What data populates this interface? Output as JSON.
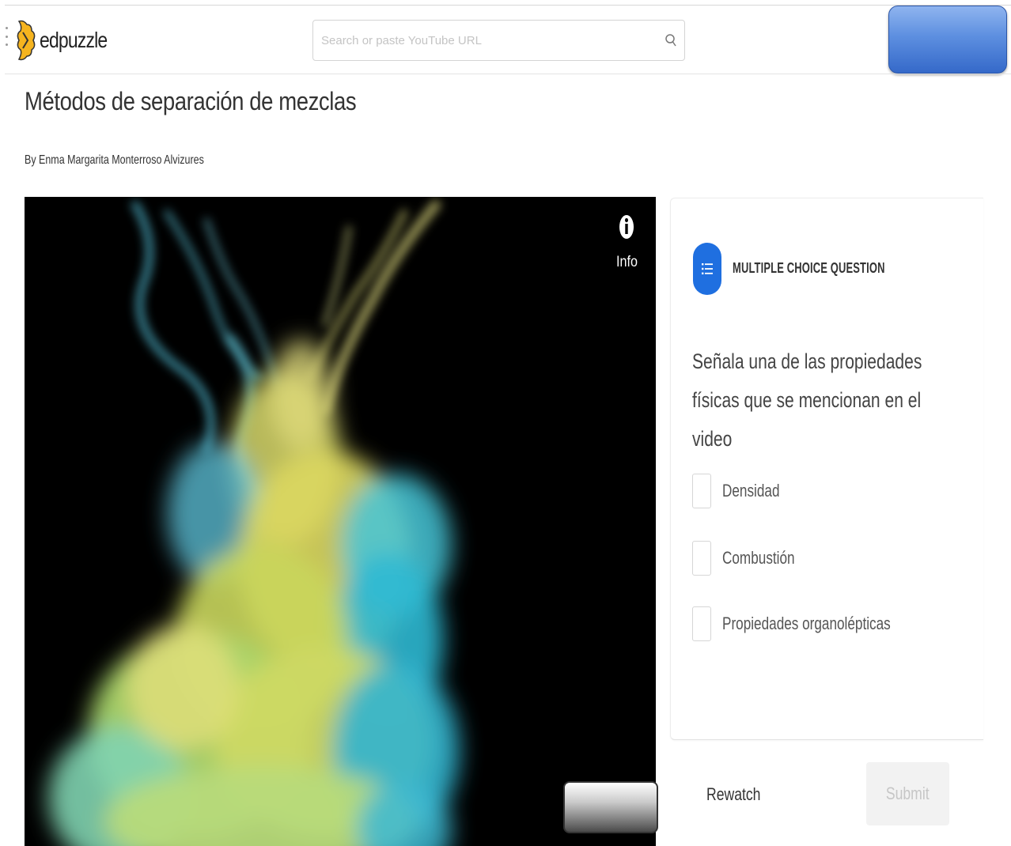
{
  "header": {
    "logo_text": "edpuzzle",
    "search_placeholder": "Search or paste YouTube URL"
  },
  "page": {
    "title": "Métodos de separación de mezclas",
    "author": "By Enma Margarita Monterroso Alvizures"
  },
  "video": {
    "info_label": "Info"
  },
  "question": {
    "type_label": "MULTIPLE CHOICE QUESTION",
    "text": "Señala una de las propiedades físicas que se mencionan en el video",
    "options": [
      {
        "label": "Densidad",
        "checked": false
      },
      {
        "label": "Combustión",
        "checked": false
      },
      {
        "label": "Propiedades organolépticas",
        "checked": false
      }
    ]
  },
  "actions": {
    "rewatch_label": "Rewatch",
    "submit_label": "Submit"
  },
  "colors": {
    "accent": "#1f6fe0",
    "logo_yellow": "#f5b41f",
    "overlay_button_blue": "#5d8fe0"
  }
}
